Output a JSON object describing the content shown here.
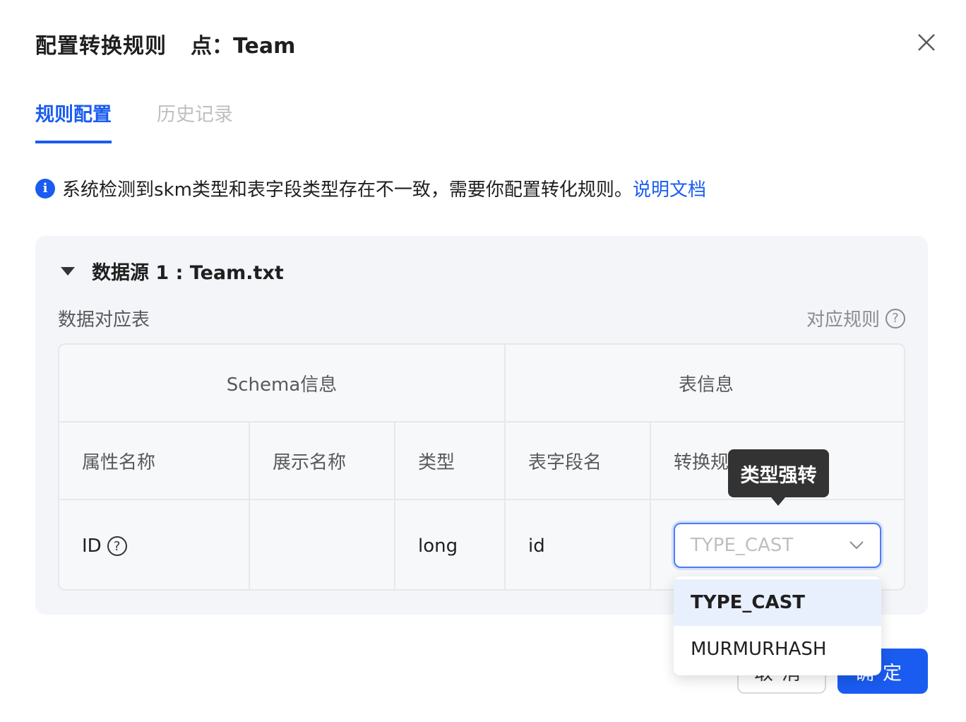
{
  "modal": {
    "title": "配置转换规则",
    "subtitle": "点：Team",
    "close_label": "×"
  },
  "tabs": [
    {
      "label": "规则配置",
      "active": true
    },
    {
      "label": "历史记录",
      "active": false
    }
  ],
  "notice": {
    "icon": "info-icon",
    "icon_glyph": "i",
    "text": "系统检测到skm类型和表字段类型存在不一致，需要你配置转化规则。",
    "link": "说明文档"
  },
  "datasource": {
    "title": "数据源 1 : Team.txt",
    "map_label": "数据对应表",
    "rule_link": "对应规则",
    "help_glyph": "?",
    "groups": {
      "schema": "Schema信息",
      "table": "表信息"
    },
    "columns": [
      "属性名称",
      "展示名称",
      "类型",
      "表字段名",
      "转换规则"
    ],
    "rows": [
      {
        "attr": "ID",
        "display": "",
        "type": "long",
        "field": "id",
        "rule": "TYPE_CAST"
      }
    ]
  },
  "select": {
    "value": "TYPE_CAST",
    "options": [
      "TYPE_CAST",
      "MURMURHASH"
    ],
    "tooltip": "类型强转"
  },
  "footer": {
    "cancel": "取消",
    "ok": "确定"
  },
  "colors": {
    "accent": "#1a5cf0",
    "panel": "#f3f5f9",
    "tooltip": "#333333"
  }
}
